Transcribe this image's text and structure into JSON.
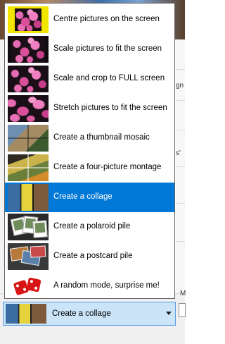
{
  "background": {
    "fragments": [
      "gn",
      "s'",
      "M"
    ]
  },
  "dropdown": {
    "items": [
      {
        "label": "Centre pictures on the screen",
        "icon": "centre-thumbnail-icon"
      },
      {
        "label": "Scale pictures to fit the screen",
        "icon": "scale-thumbnail-icon"
      },
      {
        "label": "Scale and crop to FULL screen",
        "icon": "crop-thumbnail-icon"
      },
      {
        "label": "Stretch pictures to fit the screen",
        "icon": "stretch-thumbnail-icon"
      },
      {
        "label": "Create a thumbnail mosaic",
        "icon": "mosaic-thumbnail-icon"
      },
      {
        "label": "Create a four-picture montage",
        "icon": "montage-thumbnail-icon"
      },
      {
        "label": "Create a collage",
        "icon": "collage-thumbnail-icon"
      },
      {
        "label": "Create a polaroid pile",
        "icon": "polaroid-thumbnail-icon"
      },
      {
        "label": "Create a postcard pile",
        "icon": "postcard-thumbnail-icon"
      },
      {
        "label": "A random mode, surprise me!",
        "icon": "dice-icon"
      }
    ],
    "selected_index": 6
  },
  "combo": {
    "value": "Create a collage",
    "icon": "collage-thumbnail-icon"
  },
  "colors": {
    "selection": "#0078d7",
    "combo_bg": "#cce4f7",
    "combo_border": "#569de5"
  }
}
